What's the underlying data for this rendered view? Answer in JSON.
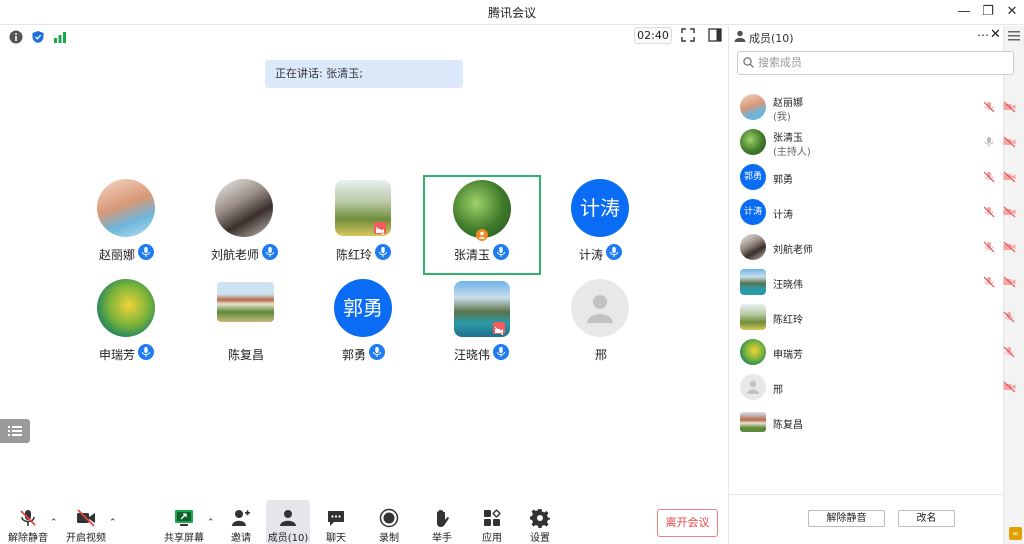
{
  "window": {
    "title": "腾讯会议"
  },
  "status": {
    "timer": "02:40"
  },
  "main": {
    "speaking_text": "正在讲话: 张清玉;",
    "participants": [
      {
        "name": "赵丽娜",
        "avatar": "photo-girl",
        "mic": true
      },
      {
        "name": "刘航老师",
        "avatar": "photo-woman",
        "mic": true
      },
      {
        "name": "陈红玲",
        "avatar": "photo-field",
        "mic": false,
        "cam_off": true
      },
      {
        "name": "张清玉",
        "avatar": "photo-leaves",
        "mic": true,
        "host": true,
        "active": true
      },
      {
        "name": "计涛",
        "avatar_text": "计涛",
        "mic": true
      },
      {
        "name": "申瑞芳",
        "avatar": "photo-parrot",
        "mic": true
      },
      {
        "name": "陈复昌",
        "avatar": "photo-building",
        "mic": false
      },
      {
        "name": "郭勇",
        "avatar_text": "郭勇",
        "mic": true
      },
      {
        "name": "汪晓伟",
        "avatar": "photo-lake",
        "mic": true,
        "cam_off": true
      },
      {
        "name": "邢",
        "avatar": "default-person",
        "mic": false
      }
    ]
  },
  "toolbar": {
    "unmute": "解除静音",
    "start_video": "开启视频",
    "share_screen": "共享屏幕",
    "invite": "邀请",
    "members": "成员(10)",
    "chat": "聊天",
    "record": "录制",
    "raise_hand": "举手",
    "apps": "应用",
    "settings": "设置",
    "leave": "离开会议"
  },
  "panel": {
    "title": "成员(10)",
    "search_placeholder": "搜索成员",
    "members": [
      {
        "name": "赵丽娜",
        "role": "(我)",
        "avatar": "photo-girl",
        "mic_muted": true,
        "cam_off": true
      },
      {
        "name": "张清玉",
        "role": "(主持人)",
        "avatar": "photo-leaves",
        "mic_muted": false,
        "cam_off": true
      },
      {
        "name": "郭勇",
        "role": "",
        "avatar_text": "郭勇",
        "mic_muted": true,
        "cam_off": true
      },
      {
        "name": "计涛",
        "role": "",
        "avatar_text": "计涛",
        "mic_muted": true,
        "cam_off": true
      },
      {
        "name": "刘航老师",
        "role": "",
        "avatar": "photo-woman",
        "mic_muted": true,
        "cam_off": true
      },
      {
        "name": "汪晓伟",
        "role": "",
        "avatar": "photo-lake",
        "mic_muted": true,
        "cam_off": true
      },
      {
        "name": "陈红玲",
        "role": "",
        "avatar": "photo-field",
        "mic_muted": true,
        "cam_off": false
      },
      {
        "name": "申瑞芳",
        "role": "",
        "avatar": "photo-parrot",
        "mic_muted": true,
        "cam_off": false
      },
      {
        "name": "邢",
        "role": "",
        "avatar": "default-person",
        "mic_muted": false,
        "cam_off": true
      },
      {
        "name": "陈复昌",
        "role": "",
        "avatar": "photo-building",
        "mic_muted": false,
        "cam_off": false
      }
    ],
    "unmute_all": "解除静音",
    "rename": "改名"
  },
  "colors": {
    "accent": "#0a6cf5",
    "active_border": "#2fb36b",
    "leave": "#e64545"
  }
}
